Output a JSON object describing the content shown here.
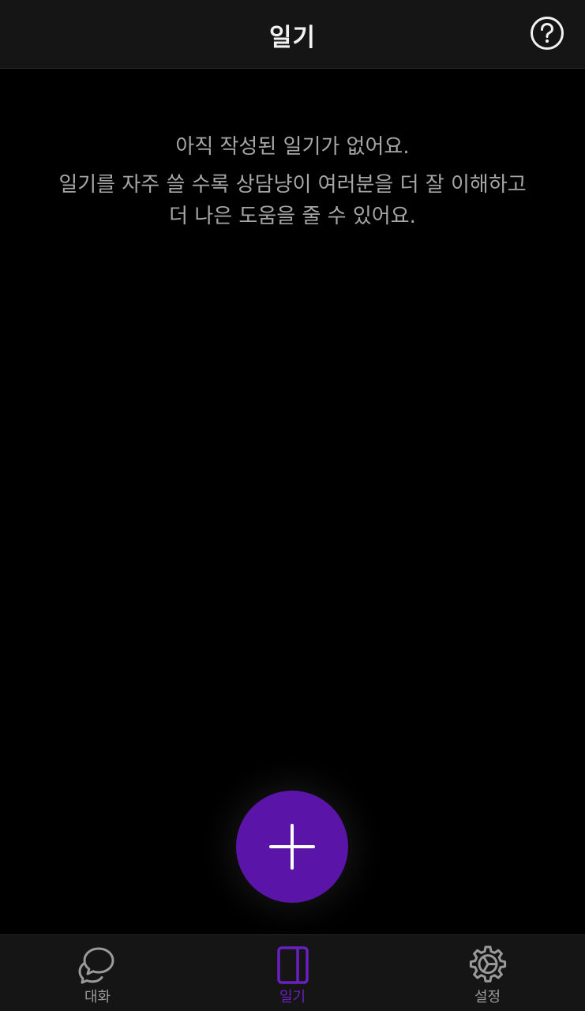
{
  "header": {
    "title": "일기",
    "help_icon": "question-circle-icon"
  },
  "empty_state": {
    "title": "아직 작성된 일기가 없어요.",
    "description_line1": "일기를 자주 쓸 수록 상담냥이 여러분을 더 잘 이해하고",
    "description_line2": "더 나은 도움을 줄 수 있어요."
  },
  "fab": {
    "icon": "plus-icon",
    "color": "#5b14a8"
  },
  "tabbar": {
    "active_color": "#6a1fc0",
    "inactive_color": "#9a9a9a",
    "tabs": [
      {
        "label": "대화",
        "icon": "chat-bubbles-icon",
        "active": false
      },
      {
        "label": "일기",
        "icon": "notebook-icon",
        "active": true
      },
      {
        "label": "설정",
        "icon": "gear-icon",
        "active": false
      }
    ]
  }
}
